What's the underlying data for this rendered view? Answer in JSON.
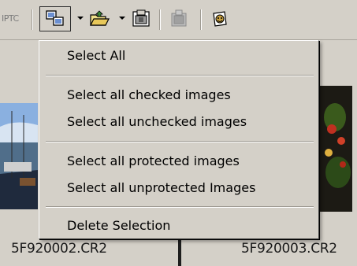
{
  "toolbar": {
    "iptc_label": "IPTC",
    "icons": [
      "select-icon",
      "open-folder-icon",
      "batch-icon",
      "delete-icon",
      "album-icon"
    ]
  },
  "menu": {
    "items": [
      {
        "label": "Select All"
      },
      {
        "label": "Select all checked images"
      },
      {
        "label": "Select all unchecked images"
      },
      {
        "label": "Select all protected images"
      },
      {
        "label": "Select all unprotected Images"
      },
      {
        "label": "Delete Selection"
      }
    ]
  },
  "thumbnails": [
    {
      "caption": "5F920002.CR2"
    },
    {
      "caption": "5F920003.CR2"
    }
  ]
}
